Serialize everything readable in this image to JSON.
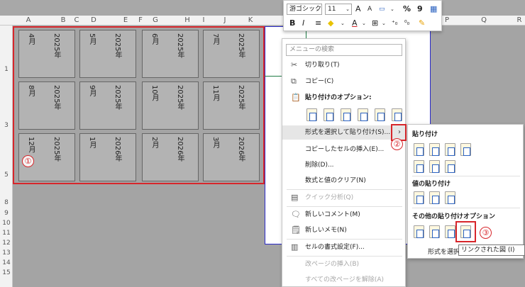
{
  "columns": [
    "A",
    "B",
    "C",
    "D",
    "E",
    "F",
    "G",
    "H",
    "I",
    "J",
    "K",
    "P",
    "Q",
    "R"
  ],
  "rows": [
    "1",
    "3",
    "5",
    "8",
    "9",
    "10",
    "11",
    "12",
    "13",
    "14",
    "15"
  ],
  "calendar": [
    [
      {
        "a": "2025年",
        "b": "4月"
      },
      {
        "a": "2025年",
        "b": "5月"
      },
      {
        "a": "2025年",
        "b": "6月"
      },
      {
        "a": "2025年",
        "b": "7月"
      }
    ],
    [
      {
        "a": "2025年",
        "b": "8月"
      },
      {
        "a": "2025年",
        "b": "9月"
      },
      {
        "a": "2025年",
        "b": "10月"
      },
      {
        "a": "2025年",
        "b": "11月"
      }
    ],
    [
      {
        "a": "2025年",
        "b": "12月"
      },
      {
        "a": "2026年",
        "b": "1月"
      },
      {
        "a": "2026年",
        "b": "2月"
      },
      {
        "a": "2026年",
        "b": "3月"
      }
    ]
  ],
  "cell_labels": {
    "left": [
      "4月",
      "8月",
      "12月",
      "5月",
      "9月",
      "1月",
      "6月",
      "10月",
      "2月",
      "7月",
      "11月",
      "3月"
    ],
    "right": [
      "2025年",
      "2025年",
      "2025年",
      "2025年",
      "2025年",
      "2026年",
      "2025年",
      "2025年",
      "2026年",
      "2025年",
      "2025年",
      "2026年"
    ]
  },
  "ribbon": {
    "font_name": "游ゴシック",
    "font_size": "11",
    "bold": "B",
    "italic": "I",
    "grow": "A",
    "shrink": "A",
    "percent": "%",
    "comma": "9"
  },
  "context_menu": {
    "search_placeholder": "メニューの検索",
    "cut": "切り取り(T)",
    "copy": "コピー(C)",
    "paste_options": "貼り付けのオプション:",
    "paste_special": "形式を選択して貼り付け(S)...",
    "insert_copied": "コピーしたセルの挿入(E)...",
    "delete": "削除(D)...",
    "clear": "数式と値のクリア(N)",
    "quick_analysis": "クイック分析(Q)",
    "new_comment": "新しいコメント(M)",
    "new_note": "新しいメモ(N)",
    "format_cells": "セルの書式設定(F)...",
    "insert_page_break": "改ページの挿入(B)",
    "reset_page_breaks": "すべての改ページを解除(A)"
  },
  "submenu": {
    "paste": "貼り付け",
    "paste_values": "値の貼り付け",
    "other_paste": "その他の貼り付けオプション",
    "paste_special_label": "形式を選択"
  },
  "tooltip": "リンクされた図 (I)",
  "badges": [
    "①",
    "②",
    "③"
  ],
  "colors": {
    "accent_red": "#d7262b",
    "grid_gray": "#a4a4a4",
    "border_blue": "#2a2ac8"
  }
}
